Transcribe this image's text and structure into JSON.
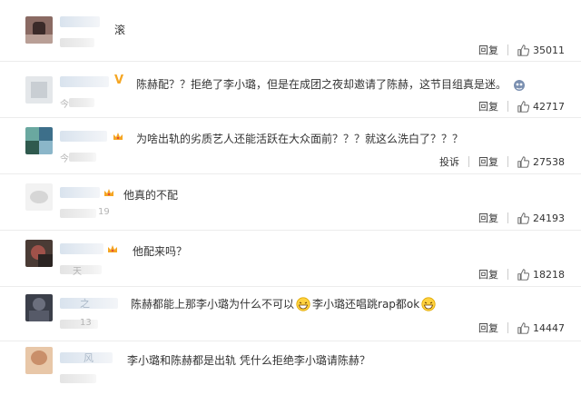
{
  "comments": [
    {
      "text": "滚",
      "time_fragment": "",
      "report": "",
      "reply": "回复",
      "likes": "35011"
    },
    {
      "text": "陈赫配？？拒绝了李小璐，但是在成团之夜却邀请了陈赫，这节目组真是迷。",
      "time_fragment": "今",
      "report": "",
      "reply": "回复",
      "likes": "42717"
    },
    {
      "text": "为啥出轨的劣质艺人还能活跃在大众面前？？？就这么洗白了？？？",
      "time_fragment": "今",
      "report": "投诉",
      "reply": "回复",
      "likes": "27538"
    },
    {
      "text": "他真的不配",
      "time_fragment": "19",
      "report": "",
      "reply": "回复",
      "likes": "24193"
    },
    {
      "text": "他配来吗？",
      "time_fragment": "天",
      "report": "",
      "reply": "回复",
      "likes": "18218"
    },
    {
      "text_a": "陈赫都能上那李小璐为什么不可以",
      "text_b": "李小璐还唱跳rap都ok",
      "name_fragment": "之",
      "time_fragment": "13",
      "report": "",
      "reply": "回复",
      "likes": "14447"
    },
    {
      "text": "李小璐和陈赫都是出轨 凭什么拒绝李小璐请陈赫？",
      "name_fragment": "风",
      "time_fragment": "",
      "report": "",
      "reply": "",
      "likes": ""
    }
  ],
  "icons": {
    "like": "thumbs-up-icon",
    "vip": "vip-badge-icon",
    "crown": "crown-icon",
    "emoji_face": "laugh-emoji-icon",
    "emoji_blob": "sticker-emoji-icon"
  },
  "colors": {
    "vip_orange": "#f5a623",
    "text": "#333333",
    "divider": "#ececec"
  }
}
